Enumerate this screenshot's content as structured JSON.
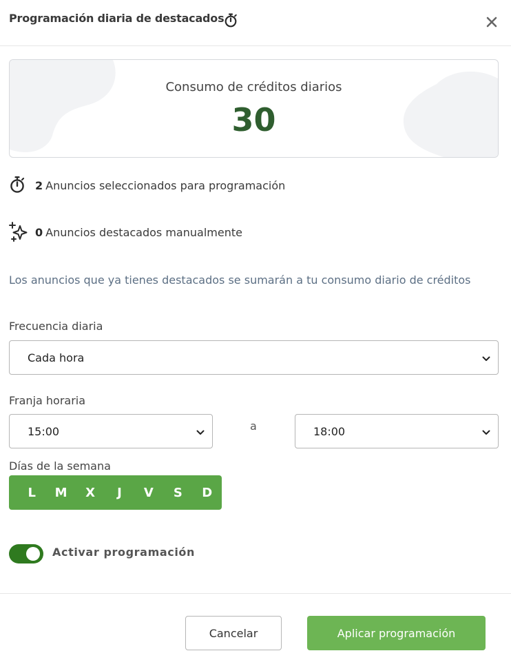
{
  "header": {
    "title": "Programación diaria de destacados",
    "title_icon": "stopwatch-icon",
    "close_icon": "close-icon"
  },
  "credits": {
    "label": "Consumo de créditos diarios",
    "value": "30"
  },
  "stats": {
    "selected_count": "2",
    "selected_label": "Anuncios seleccionados para programación",
    "selected_icon": "stopwatch-icon",
    "manual_count": "0",
    "manual_label": "Anuncios destacados manualmente",
    "manual_icon": "sparkles-icon"
  },
  "notice": "Los anuncios que ya tienes destacados se sumarán a tu consumo diario de créditos",
  "frequency": {
    "label": "Frecuencia diaria",
    "value": "Cada hora"
  },
  "time_range": {
    "label": "Franja horaria",
    "from": "15:00",
    "separator": "a",
    "to": "18:00"
  },
  "weekdays": {
    "label": "Días de la semana",
    "days": [
      "L",
      "M",
      "X",
      "J",
      "V",
      "S",
      "D"
    ]
  },
  "activation": {
    "label": "Activar programación",
    "enabled": true
  },
  "footer": {
    "cancel_label": "Cancelar",
    "apply_label": "Aplicar programación"
  },
  "colors": {
    "accent": "#6db554",
    "days_bg": "#5aa646",
    "toggle_on": "#2f7a1f",
    "credits_value": "#2f5e2f",
    "notice_text": "#5c6f84"
  }
}
